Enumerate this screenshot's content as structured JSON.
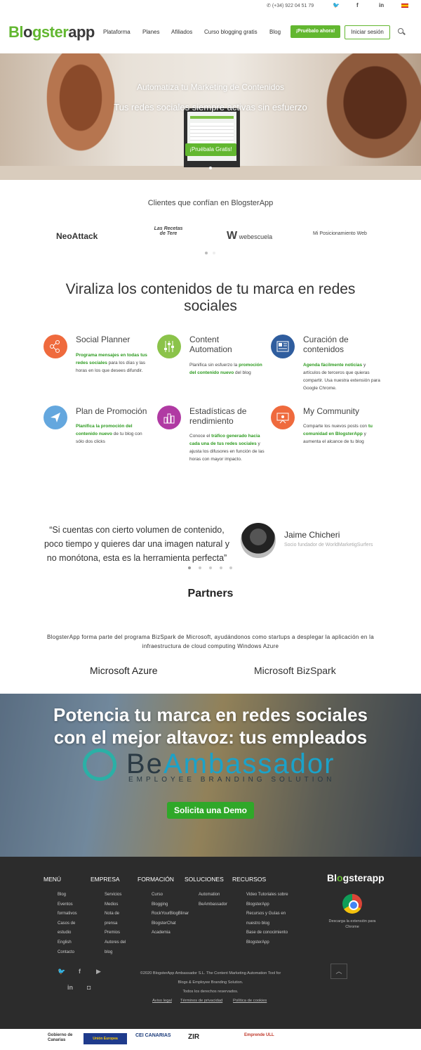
{
  "topbar": {
    "phone": "(+34) 922 04 51 79"
  },
  "header": {
    "logo_a": "Bl",
    "logo_g": "o",
    "logo_b": "gster",
    "logo_c": "app",
    "nav": [
      "Plataforma",
      "Planes",
      "Afiliados",
      "Curso blogging gratis",
      "Blog"
    ],
    "cta": "¡Pruébalo ahora!",
    "login": "Iniciar sesión"
  },
  "hero": {
    "title": "Automatiza tu Marketing de Contenidos",
    "subtitle": "Tus redes sociales siempre activas sin esfuerzo",
    "button": "¡Pruébala Gratis!"
  },
  "clients": {
    "title": "Clientes que confían en BlogsterApp",
    "logos": [
      "NeoAttack",
      "Las Recetas de Tere",
      "webescuela",
      "Mi Posicionamiento Web"
    ]
  },
  "features": {
    "title": "Viraliza los contenidos de tu marca en redes sociales",
    "items": [
      {
        "title": "Social Planner",
        "hl1": "Programa mensajes en todas tus redes sociales",
        "t1": " para los días y las horas en los que desees difundir.",
        "color": "#ef6a3d"
      },
      {
        "title": "Content Automation",
        "t0": "Planifica sin esfuerzo la ",
        "hl1": "promoción del contenido nuevo",
        "t1": " del blog",
        "color": "#8bc34a"
      },
      {
        "title": "Curación de contenidos",
        "hl1": "Agenda fácilmente noticias",
        "t1": " y artículos de terceros que quieras compartir. Usa nuestra extensión para Google Chrome.",
        "color": "#2f5d9e"
      },
      {
        "title": "Plan de Promoción",
        "hl1": "Planifica la promoción del contenido nuevo",
        "t1": " de tu blog con sólo dos clicks",
        "color": "#64a7de"
      },
      {
        "title": "Estadísticas de rendimiento",
        "t0": "Conoce el ",
        "hl1": "tráfico generado hacia cada una de tus redes sociales",
        "t1": " y ajusta los difusores en función de las horas con mayor impacto.",
        "color": "#b03aa3"
      },
      {
        "title": "My Community",
        "t0": "Comparte los nuevos posts con ",
        "hl1": "tu comunidad en BlogsterApp",
        "t1": " y aumenta el alcance de tu blog",
        "color": "#ef6a3d"
      }
    ]
  },
  "testimonial": {
    "quote": "“Si cuentas con cierto volumen de contenido, poco tiempo y quieres dar una imagen natural y no monótona, esta es la herramienta perfecta”",
    "name": "Jaime Chicheri",
    "role": "Socio fundador de WorldMarketigSurfers"
  },
  "partners": {
    "title": "Partners",
    "text": "BlogsterApp forma parte del programa BizSpark de Microsoft, ayudándonos como startups a desplegar la aplicación en la infraestructura de cloud computing Windows Azure",
    "logo1": "Microsoft Azure",
    "logo2": "Microsoft BizSpark"
  },
  "ambassador": {
    "title": "Potencia tu marca en redes sociales con el mejor altavoz: tus empleados",
    "brand_a": "Be",
    "brand_b": "Ambassador",
    "tagline": "EMPLOYEE BRANDING SOLUTION",
    "button": "Solicita una Demo"
  },
  "footer": {
    "cols": [
      {
        "head": "MENÚ",
        "items": [
          "Blog",
          "Eventos",
          "formativos",
          "Casos de",
          "estudio",
          "English",
          "Contacto"
        ]
      },
      {
        "head": "EMPRESA",
        "items": [
          "Servicios",
          "Medios",
          "Nota de",
          "prensa",
          "Premios",
          "Autores del",
          "blog"
        ]
      },
      {
        "head": "FORMACIÓN",
        "items": [
          "Curso",
          "Blogging",
          "RockYourBlogBlinar",
          "BlogsterChat",
          "Academia"
        ]
      },
      {
        "head": "SOLUCIONES",
        "items": [
          "Automation",
          "BeAmbassador"
        ]
      },
      {
        "head": "RECURSOS",
        "items": [
          "Video Tutoriales sobre",
          "BlogsterApp",
          "Recursos y Guías en",
          "nuestro blog",
          "Base de conocimiento",
          "BlogsterApp"
        ]
      }
    ],
    "ext": "Descarga la extensión para Chrome",
    "copy1": "©2020 BlogsterApp Ambassador S.L. The Content Marketing Automation Tool for",
    "copy2": "Blogs & Employee Branding Solution.",
    "copy3": "Todos los derechos reservados.",
    "legal": [
      "Aviso legal",
      "Términos de privacidad",
      "Política de cookies"
    ]
  },
  "sponsors": [
    "Gobierno de Canarias",
    "Unión Europea",
    "CEI CANARIAS",
    "ZIR",
    "Emprende ULL"
  ]
}
